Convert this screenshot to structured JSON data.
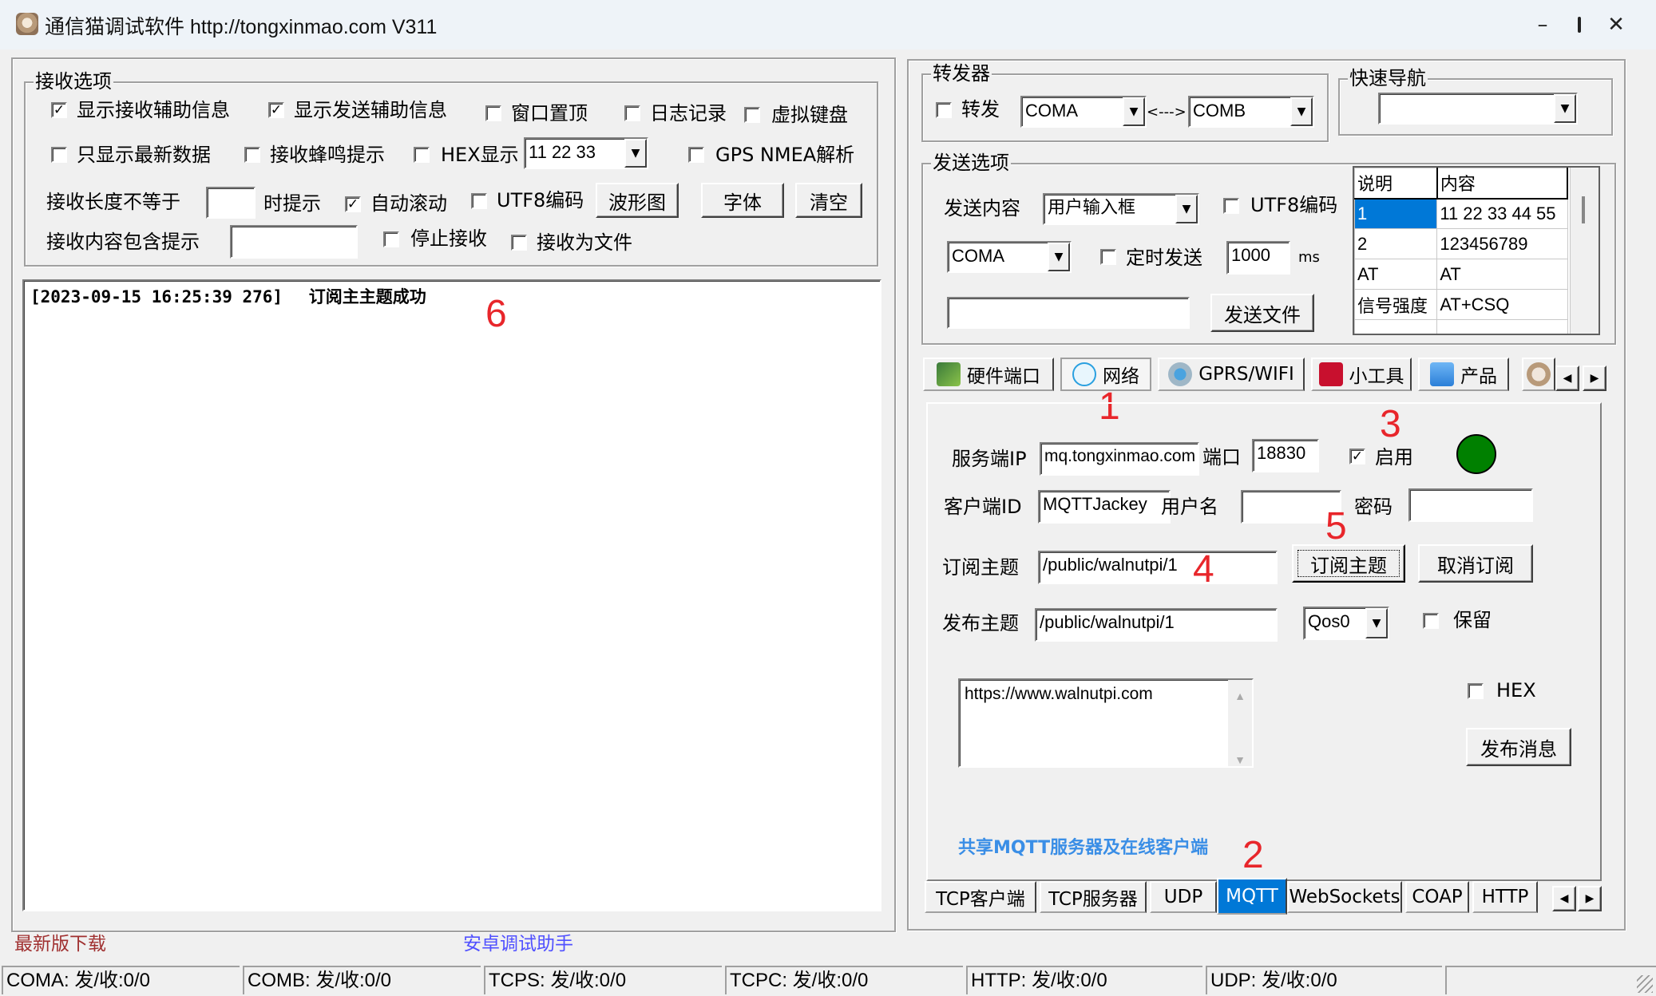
{
  "window": {
    "title": "通信猫调试软件  http://tongxinmao.com  V311",
    "controls": {
      "minimize": "–",
      "maximize": "☐",
      "close": "✕"
    }
  },
  "receive_options": {
    "title": "接收选项",
    "show_recv_info": {
      "label": "显示接收辅助信息",
      "checked": true
    },
    "show_send_info": {
      "label": "显示发送辅助信息",
      "checked": true
    },
    "window_top": {
      "label": "窗口置顶",
      "checked": false
    },
    "log": {
      "label": "日志记录",
      "checked": false
    },
    "virtual_keyboard": {
      "label": "虚拟键盘",
      "checked": false
    },
    "latest_only": {
      "label": "只显示最新数据",
      "checked": false
    },
    "beep": {
      "label": "接收蜂鸣提示",
      "checked": false
    },
    "hex_display": {
      "label": "HEX显示",
      "checked": false
    },
    "hex_format": "11 22 33",
    "gps_nmea": {
      "label": "GPS NMEA解析",
      "checked": false
    },
    "len_not_equal_label": "接收长度不等于",
    "len_not_equal_value": "",
    "hint_label": "时提示",
    "auto_scroll": {
      "label": "自动滚动",
      "checked": true
    },
    "utf8": {
      "label": "UTF8编码",
      "checked": false
    },
    "waveform_button": "波形图",
    "font_button": "字体",
    "clear_button": "清空",
    "contains_label": "接收内容包含提示",
    "contains_value": "",
    "stop_receive": {
      "label": "停止接收",
      "checked": false
    },
    "receive_to_file": {
      "label": "接收为文件",
      "checked": false
    }
  },
  "receive_area": {
    "lines": [
      {
        "timestamp": "[2023-09-15 16:25:39 276]",
        "message": "订阅主主题成功"
      }
    ]
  },
  "bottom_links": {
    "download": "最新版下载",
    "android": "安卓调试助手"
  },
  "forwarder": {
    "title": "转发器",
    "forward": {
      "label": "转发",
      "checked": false
    },
    "from": "COMA",
    "arrow": "<--->",
    "to": "COMB"
  },
  "quick_nav": {
    "title": "快速导航",
    "value": ""
  },
  "send_options": {
    "title": "发送选项",
    "content_label": "发送内容",
    "content_source": "用户输入框",
    "utf8": {
      "label": "UTF8编码",
      "checked": false
    },
    "port": "COMA",
    "timed_send": {
      "label": "定时发送",
      "checked": false
    },
    "interval": "1000",
    "interval_unit": "ms",
    "file_path": "",
    "send_file_button": "发送文件",
    "table": {
      "headers": [
        "说明",
        "内容"
      ],
      "rows": [
        {
          "desc": "1",
          "content": "11 22 33 44 55",
          "selected": true
        },
        {
          "desc": "2",
          "content": "123456789",
          "selected": false
        },
        {
          "desc": "AT",
          "content": "AT",
          "selected": false
        },
        {
          "desc": "信号强度",
          "content": "AT+CSQ",
          "selected": false
        },
        {
          "desc": "",
          "content": "",
          "selected": false
        }
      ]
    }
  },
  "main_tabs": [
    {
      "label": "硬件端口",
      "icon": "circuit-board-icon",
      "active": false
    },
    {
      "label": "网络",
      "icon": "network-icon",
      "active": true
    },
    {
      "label": "GPRS/WIFI",
      "icon": "antenna-icon",
      "active": false
    },
    {
      "label": "小工具",
      "icon": "toolbox-icon",
      "active": false
    },
    {
      "label": "产品",
      "icon": "usb-drive-icon",
      "active": false
    }
  ],
  "mqtt": {
    "server_ip_label": "服务端IP",
    "server_ip": "mq.tongxinmao.com",
    "port_label": "端口",
    "port": "18830",
    "enable": {
      "label": "启用",
      "checked": true
    },
    "status_color": "#008000",
    "client_id_label": "客户端ID",
    "client_id": "MQTTJackey",
    "username_label": "用户名",
    "username": "",
    "password_label": "密码",
    "password": "",
    "subscribe_topic_label": "订阅主题",
    "subscribe_topic": "/public/walnutpi/1",
    "subscribe_button": "订阅主题",
    "unsubscribe_button": "取消订阅",
    "publish_topic_label": "发布主题",
    "publish_topic": "/public/walnutpi/1",
    "qos": "Qos0",
    "retain": {
      "label": "保留",
      "checked": false
    },
    "message": "https://www.walnutpi.com",
    "hex": {
      "label": "HEX",
      "checked": false
    },
    "publish_button": "发布消息",
    "shared_link": "共享MQTT服务器及在线客户端"
  },
  "network_tabs": [
    {
      "label": "TCP客户端",
      "active": false
    },
    {
      "label": "TCP服务器",
      "active": false
    },
    {
      "label": "UDP",
      "active": false
    },
    {
      "label": "MQTT",
      "active": true
    },
    {
      "label": "WebSockets",
      "active": false
    },
    {
      "label": "COAP",
      "active": false
    },
    {
      "label": "HTTP",
      "active": false
    }
  ],
  "annotations": [
    "1",
    "2",
    "3",
    "4",
    "5",
    "6"
  ],
  "status_bar": [
    "COMA: 发/收:0/0",
    "COMB: 发/收:0/0",
    "TCPS: 发/收:0/0",
    "TCPC: 发/收:0/0",
    "HTTP: 发/收:0/0",
    "UDP: 发/收:0/0",
    ""
  ],
  "colors": {
    "accent": "#0078d7",
    "annotation": "#e8262b",
    "download_link": "#a03030",
    "android_link": "#5050ff",
    "shared_link": "#3a8ee6"
  }
}
